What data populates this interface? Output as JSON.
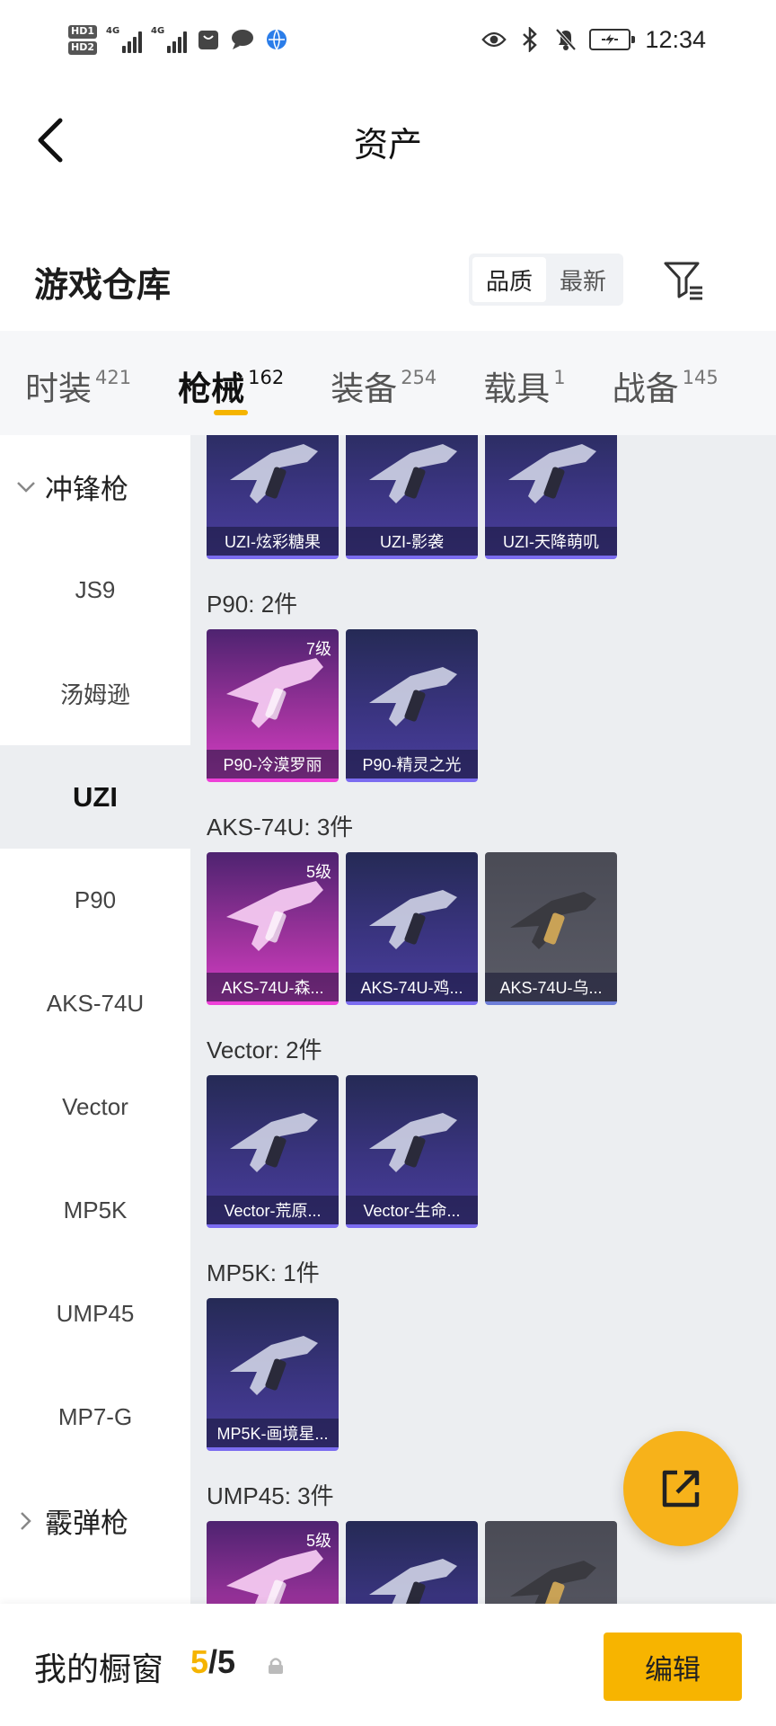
{
  "status_bar": {
    "hd1": "HD1",
    "hd2": "HD2",
    "signal_label": "4G",
    "time": "12:34"
  },
  "header": {
    "title": "资产"
  },
  "warehouse": {
    "title": "游戏仓库",
    "sort_options": [
      "品质",
      "最新"
    ],
    "active_sort": "品质"
  },
  "tabs": [
    {
      "label": "时装",
      "count": "421"
    },
    {
      "label": "枪械",
      "count": "162",
      "active": true
    },
    {
      "label": "装备",
      "count": "254"
    },
    {
      "label": "载具",
      "count": "1"
    },
    {
      "label": "战备",
      "count": "145"
    }
  ],
  "sidebar": {
    "cat_smg": "冲锋枪",
    "items": [
      "JS9",
      "汤姆逊",
      "UZI",
      "P90",
      "AKS-74U",
      "Vector",
      "MP5K",
      "UMP45",
      "MP7-G"
    ],
    "active_item": "UZI",
    "cat_shotgun": "霰弹枪"
  },
  "groups": [
    {
      "title": "",
      "cards": [
        {
          "name": "UZI-炫彩糖果",
          "rarity": "purple",
          "level": ""
        },
        {
          "name": "UZI-影袭",
          "rarity": "purple",
          "level": ""
        },
        {
          "name": "UZI-天降萌叽",
          "rarity": "purple",
          "level": ""
        }
      ]
    },
    {
      "title": "P90: 2件",
      "cards": [
        {
          "name": "P90-冷漠罗丽",
          "rarity": "pink",
          "level": "7级"
        },
        {
          "name": "P90-精灵之光",
          "rarity": "purple",
          "level": ""
        }
      ]
    },
    {
      "title": "AKS-74U: 3件",
      "cards": [
        {
          "name": "AKS-74U-森...",
          "rarity": "pink",
          "level": "5级"
        },
        {
          "name": "AKS-74U-鸡...",
          "rarity": "purple",
          "level": ""
        },
        {
          "name": "AKS-74U-乌...",
          "rarity": "grey",
          "level": ""
        }
      ]
    },
    {
      "title": "Vector: 2件",
      "cards": [
        {
          "name": "Vector-荒原...",
          "rarity": "purple",
          "level": ""
        },
        {
          "name": "Vector-生命...",
          "rarity": "purple",
          "level": ""
        }
      ]
    },
    {
      "title": "MP5K: 1件",
      "cards": [
        {
          "name": "MP5K-画境星...",
          "rarity": "purple",
          "level": ""
        }
      ]
    },
    {
      "title": "UMP45: 3件",
      "cards": [
        {
          "name": "",
          "rarity": "pink",
          "level": "5级"
        },
        {
          "name": "",
          "rarity": "purple",
          "level": ""
        },
        {
          "name": "",
          "rarity": "grey",
          "level": ""
        }
      ]
    }
  ],
  "bottom": {
    "window_label": "我的橱窗",
    "used": "5",
    "sep": "/",
    "total": "5",
    "edit_label": "编辑"
  },
  "colors": {
    "accent": "#f5b400",
    "rarity_purple": "#7b6cf0",
    "rarity_pink": "#ee40d8",
    "rarity_grey": "#6d7ed8"
  }
}
